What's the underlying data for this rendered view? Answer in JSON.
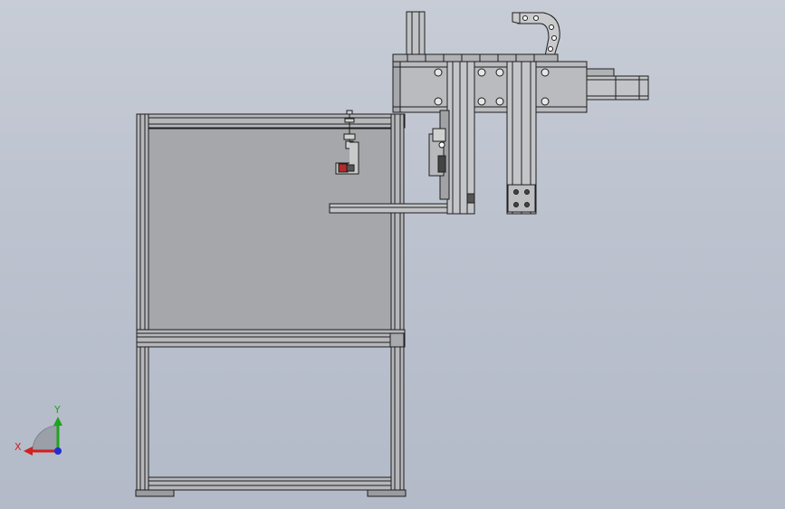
{
  "viewport": {
    "view": "front",
    "background_colors": [
      "#c7ccd6",
      "#b3bac8"
    ]
  },
  "model": {
    "colors": {
      "edge": "#1e1e1e",
      "frame_fill": "#b5b7bb",
      "panel_fill": "#a4a6aa",
      "rail_fill": "#c0c2c5",
      "dark_part": "#555555",
      "red_part": "#b52a2a"
    }
  },
  "triad": {
    "x_label": "X",
    "y_label": "Y",
    "x_color": "#d21f1f",
    "y_color": "#1fa31f",
    "z_color": "#1f2fd2"
  }
}
